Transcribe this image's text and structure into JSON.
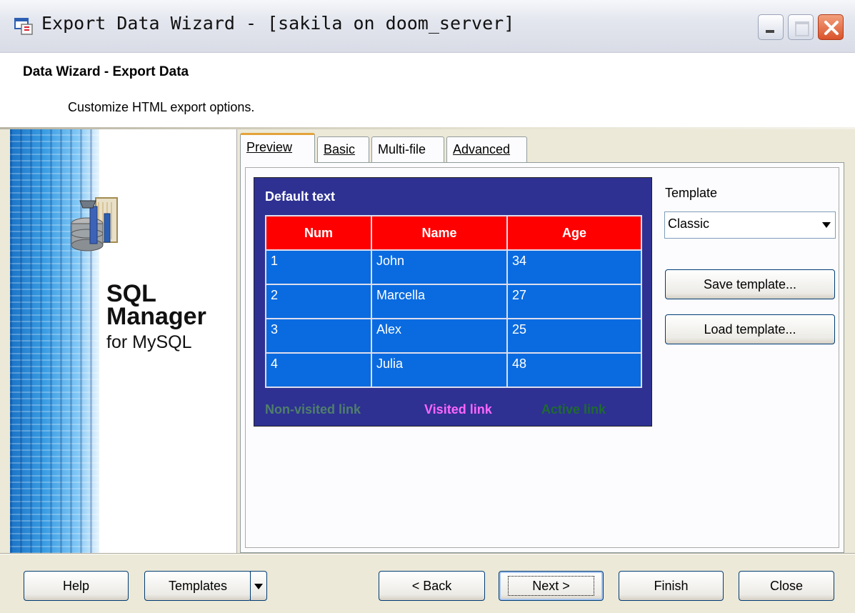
{
  "window": {
    "title": "Export Data Wizard - [sakila on doom_server]",
    "app_icon": "export-wizard-icon"
  },
  "header": {
    "title": "Data Wizard - Export Data",
    "subtitle": "Customize HTML export options."
  },
  "banner": {
    "line1": "SQL",
    "line2": "Manager",
    "line3": "for MySQL"
  },
  "tabs": [
    {
      "label": "Preview",
      "active": true
    },
    {
      "label": "Basic",
      "active": false
    },
    {
      "label": "Multi-file",
      "active": false
    },
    {
      "label": "Advanced",
      "active": false
    }
  ],
  "preview": {
    "default_text": "Default text",
    "columns": [
      "Num",
      "Name",
      "Age"
    ],
    "rows": [
      [
        "1",
        "John",
        "34"
      ],
      [
        "2",
        "Marcella",
        "27"
      ],
      [
        "3",
        "Alex",
        "25"
      ],
      [
        "4",
        "Julia",
        "48"
      ]
    ],
    "links": {
      "non_visited": "Non-visited link",
      "visited": "Visited link",
      "active": "Active link"
    },
    "colors": {
      "background": "#2e3192",
      "header_bg": "#ff0000",
      "row_bg": "#0a6be0",
      "non_visited": "#4f7f6a",
      "visited": "#ff66ff",
      "active": "#1f6b2f"
    }
  },
  "template": {
    "label": "Template",
    "selected": "Classic",
    "save_label": "Save template...",
    "load_label": "Load template..."
  },
  "footer": {
    "help": "Help",
    "templates": "Templates",
    "back": "< Back",
    "next": "Next >",
    "finish": "Finish",
    "close": "Close"
  }
}
